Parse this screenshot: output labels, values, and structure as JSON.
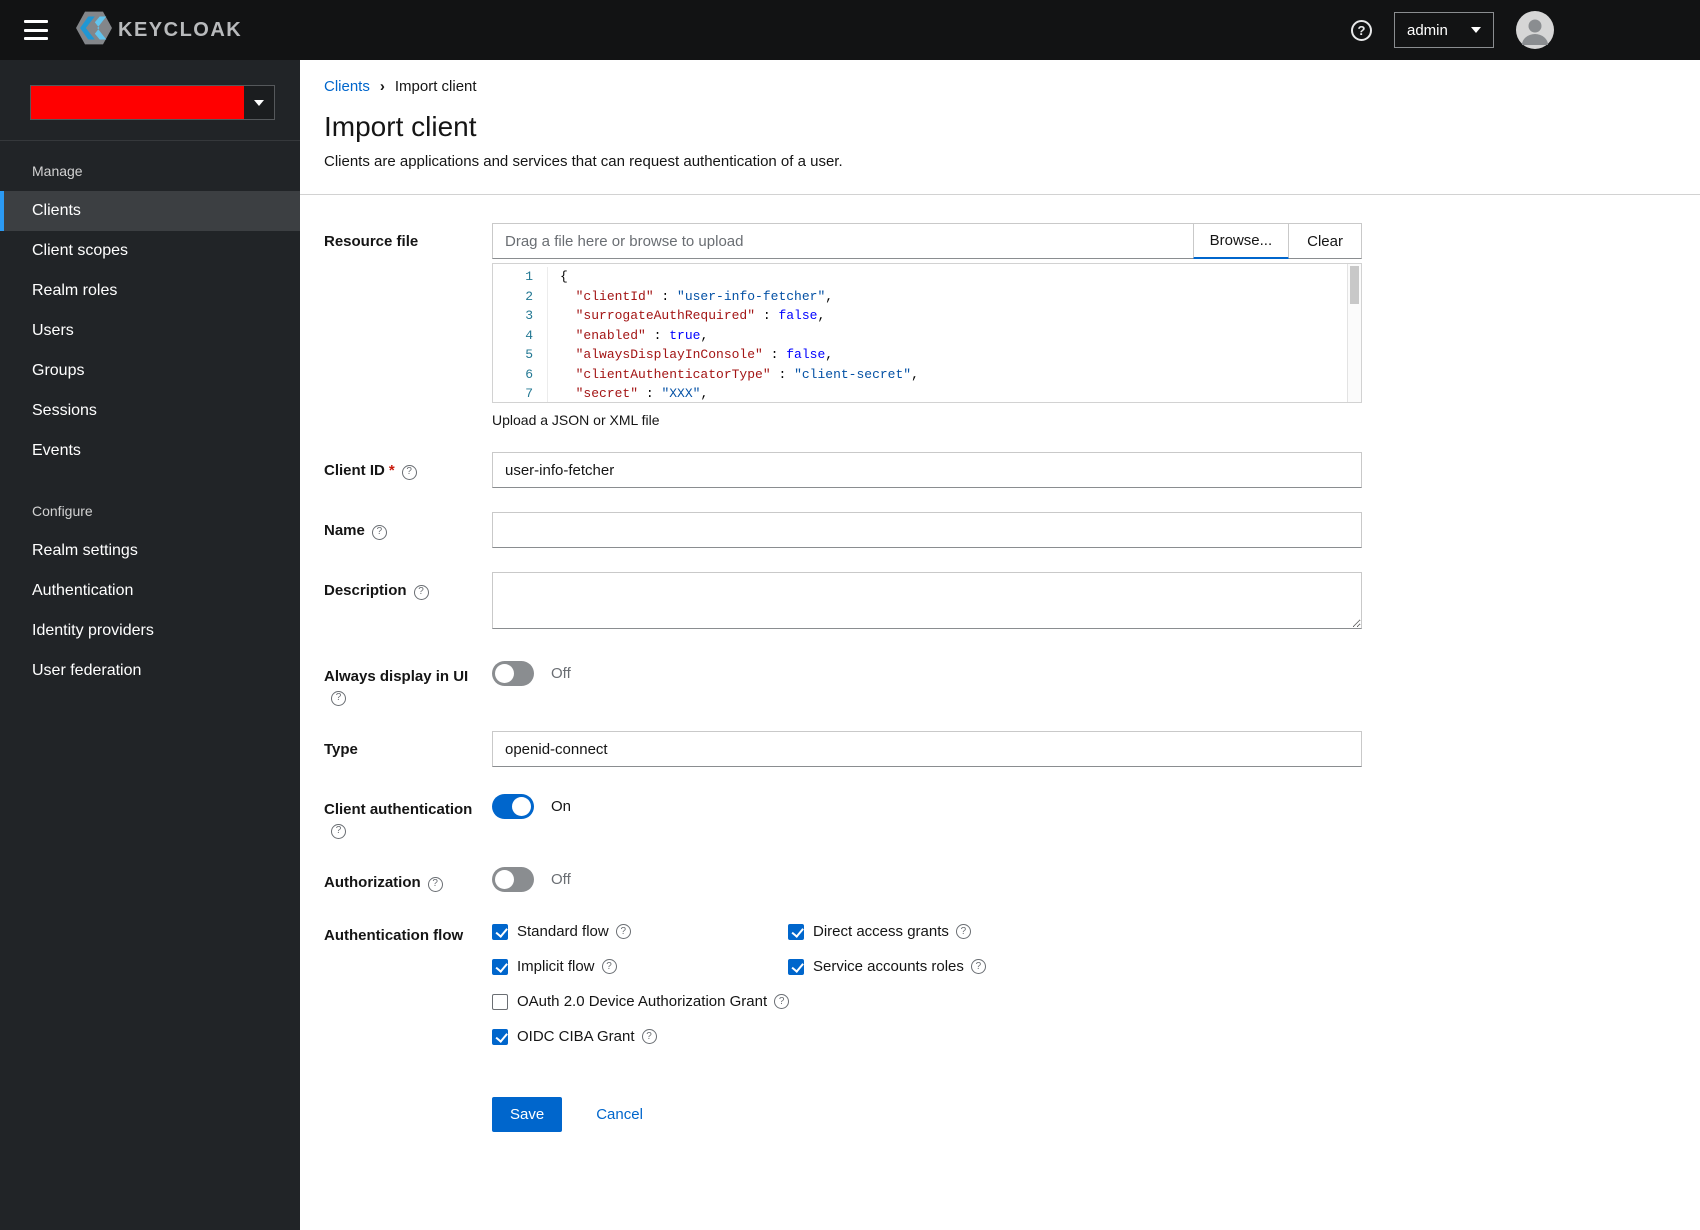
{
  "topbar": {
    "brand": "KEYCLOAK",
    "user_menu": "admin"
  },
  "sidebar": {
    "sections": [
      {
        "heading": "Manage",
        "items": [
          {
            "label": "Clients",
            "selected": true
          },
          {
            "label": "Client scopes",
            "selected": false
          },
          {
            "label": "Realm roles",
            "selected": false
          },
          {
            "label": "Users",
            "selected": false
          },
          {
            "label": "Groups",
            "selected": false
          },
          {
            "label": "Sessions",
            "selected": false
          },
          {
            "label": "Events",
            "selected": false
          }
        ]
      },
      {
        "heading": "Configure",
        "items": [
          {
            "label": "Realm settings",
            "selected": false
          },
          {
            "label": "Authentication",
            "selected": false
          },
          {
            "label": "Identity providers",
            "selected": false
          },
          {
            "label": "User federation",
            "selected": false
          }
        ]
      }
    ]
  },
  "breadcrumb": {
    "items": [
      "Clients",
      "Import client"
    ]
  },
  "page": {
    "title": "Import client",
    "subtitle": "Clients are applications and services that can request authentication of a user."
  },
  "form": {
    "resource_file": {
      "label": "Resource file",
      "placeholder": "Drag a file here or browse to upload",
      "browse": "Browse...",
      "clear": "Clear",
      "helper": "Upload a JSON or XML file"
    },
    "code_editor": {
      "lines": [
        {
          "num": "1",
          "tokens": [
            {
              "t": "{",
              "c": "punct"
            }
          ]
        },
        {
          "num": "2",
          "tokens": [
            {
              "t": "  ",
              "c": "punct"
            },
            {
              "t": "\"clientId\"",
              "c": "key"
            },
            {
              "t": " : ",
              "c": "punct"
            },
            {
              "t": "\"user-info-fetcher\"",
              "c": "string"
            },
            {
              "t": ",",
              "c": "punct"
            }
          ]
        },
        {
          "num": "3",
          "tokens": [
            {
              "t": "  ",
              "c": "punct"
            },
            {
              "t": "\"surrogateAuthRequired\"",
              "c": "key"
            },
            {
              "t": " : ",
              "c": "punct"
            },
            {
              "t": "false",
              "c": "bool"
            },
            {
              "t": ",",
              "c": "punct"
            }
          ]
        },
        {
          "num": "4",
          "tokens": [
            {
              "t": "  ",
              "c": "punct"
            },
            {
              "t": "\"enabled\"",
              "c": "key"
            },
            {
              "t": " : ",
              "c": "punct"
            },
            {
              "t": "true",
              "c": "bool"
            },
            {
              "t": ",",
              "c": "punct"
            }
          ]
        },
        {
          "num": "5",
          "tokens": [
            {
              "t": "  ",
              "c": "punct"
            },
            {
              "t": "\"alwaysDisplayInConsole\"",
              "c": "key"
            },
            {
              "t": " : ",
              "c": "punct"
            },
            {
              "t": "false",
              "c": "bool"
            },
            {
              "t": ",",
              "c": "punct"
            }
          ]
        },
        {
          "num": "6",
          "tokens": [
            {
              "t": "  ",
              "c": "punct"
            },
            {
              "t": "\"clientAuthenticatorType\"",
              "c": "key"
            },
            {
              "t": " : ",
              "c": "punct"
            },
            {
              "t": "\"client-secret\"",
              "c": "string"
            },
            {
              "t": ",",
              "c": "punct"
            }
          ]
        },
        {
          "num": "7",
          "tokens": [
            {
              "t": "  ",
              "c": "punct"
            },
            {
              "t": "\"secret\"",
              "c": "key"
            },
            {
              "t": " : ",
              "c": "punct"
            },
            {
              "t": "\"XXX\"",
              "c": "string"
            },
            {
              "t": ",",
              "c": "punct"
            }
          ]
        }
      ]
    },
    "client_id": {
      "label": "Client ID",
      "required": "*",
      "value": "user-info-fetcher"
    },
    "name": {
      "label": "Name",
      "value": ""
    },
    "description": {
      "label": "Description",
      "value": ""
    },
    "always_display": {
      "label": "Always display in UI",
      "state": "Off"
    },
    "type": {
      "label": "Type",
      "value": "openid-connect"
    },
    "client_auth": {
      "label": "Client authentication",
      "state": "On"
    },
    "authorization": {
      "label": "Authorization",
      "state": "Off"
    },
    "auth_flow": {
      "label": "Authentication flow",
      "options": [
        {
          "label": "Standard flow",
          "checked": true
        },
        {
          "label": "Direct access grants",
          "checked": true
        },
        {
          "label": "Implicit flow",
          "checked": true
        },
        {
          "label": "Service accounts roles",
          "checked": true
        },
        {
          "label": "OAuth 2.0 Device Authorization Grant",
          "checked": false
        },
        {
          "label": "OIDC CIBA Grant",
          "checked": true
        }
      ]
    },
    "actions": {
      "save": "Save",
      "cancel": "Cancel"
    }
  },
  "colors": {
    "primary": "#0066cc",
    "selected_accent": "#2b9af3",
    "realm_redacted": "#ff0000",
    "masthead": "#121314",
    "sidebar": "#212427"
  }
}
